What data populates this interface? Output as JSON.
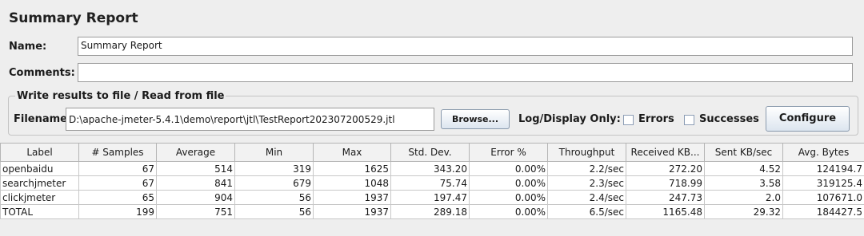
{
  "title": "Summary Report",
  "name": {
    "label": "Name:",
    "value": "Summary Report"
  },
  "comments": {
    "label": "Comments:",
    "value": ""
  },
  "file_section": {
    "title": "Write results to file / Read from file",
    "filename_label": "Filename",
    "filename_value": "D:\\apache-jmeter-5.4.1\\demo\\report\\jtl\\TestReport202307200529.jtl",
    "browse_label": "Browse...",
    "log_display_label": "Log/Display Only:",
    "errors_label": "Errors",
    "errors_checked": false,
    "successes_label": "Successes",
    "successes_checked": false,
    "configure_label": "Configure"
  },
  "table": {
    "columns": [
      "Label",
      "# Samples",
      "Average",
      "Min",
      "Max",
      "Std. Dev.",
      "Error %",
      "Throughput",
      "Received KB...",
      "Sent KB/sec",
      "Avg. Bytes"
    ],
    "rows": [
      [
        "openbaidu",
        "67",
        "514",
        "319",
        "1625",
        "343.20",
        "0.00%",
        "2.2/sec",
        "272.20",
        "4.52",
        "124194.7"
      ],
      [
        "searchjmeter",
        "67",
        "841",
        "679",
        "1048",
        "75.74",
        "0.00%",
        "2.3/sec",
        "718.99",
        "3.58",
        "319125.4"
      ],
      [
        "clickjmeter",
        "65",
        "904",
        "56",
        "1937",
        "197.47",
        "0.00%",
        "2.4/sec",
        "247.73",
        "2.0",
        "107671.0"
      ],
      [
        "TOTAL",
        "199",
        "751",
        "56",
        "1937",
        "289.18",
        "0.00%",
        "6.5/sec",
        "1165.48",
        "29.32",
        "184427.5"
      ]
    ]
  }
}
